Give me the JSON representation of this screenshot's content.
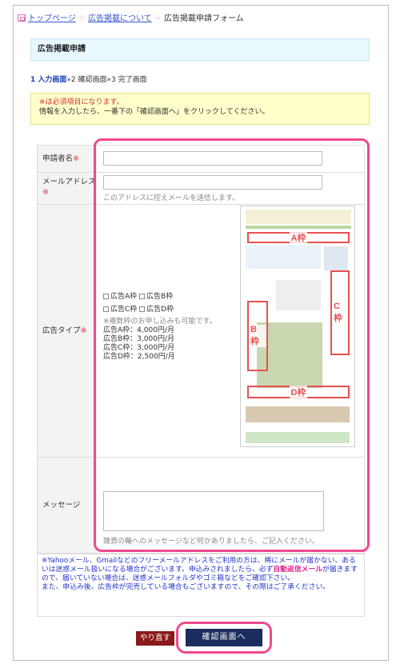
{
  "breadcrumb": {
    "home": "トップページ",
    "about": "広告掲載について",
    "current": "広告掲載申請フォーム"
  },
  "page_title": "広告掲載申請",
  "steps": {
    "step1": "1 入力画面",
    "step2": "»2 確認画面»3 完了画面"
  },
  "notice": {
    "line1": "※は必須項目になります。",
    "line2": "情報を入力したら、一番下の「確認画面へ」をクリックしてください。"
  },
  "form": {
    "name_label": "申請者名",
    "email_label": "メールアドレス",
    "email_hint": "このアドレスに控えメールを送信します。",
    "type_label": "広告タイプ",
    "required_mark": "※",
    "option_a": "広告A枠",
    "option_b": "広告B枠",
    "option_c": "広告C枠",
    "option_d": "広告D枠",
    "multi_note": "※複数枠のお申し込みも可能です。",
    "price_a": "広告A枠：4,000円/月",
    "price_b": "広告B枠：3,000円/月",
    "price_c": "広告C枠：3,000円/月",
    "price_d": "広告D枠：2,500円/月",
    "message_label": "メッセージ",
    "message_hint": "雑貨の輪へのメッセージなど何かありましたら、ご記入ください。"
  },
  "thumbnail": {
    "zone_a": "A枠",
    "zone_b": "B枠",
    "zone_c": "C枠",
    "zone_d": "D枠"
  },
  "footnote": {
    "part1": "※Yahooメール、Gmailなどのフリーメールアドレスをご利用の方は、稀にメールが届かない、あるいは迷惑メール扱いになる場合がございます。申込みされましたら、必ず",
    "highlight": "自動返信メール",
    "part2": "が届きますので、届いていない場合は、迷惑メールフォルダやゴミ箱などをご確認下さい。",
    "part3": "また、申込み後、広告枠が完売している場合もございますので、その際はご了承ください。"
  },
  "buttons": {
    "reset": "やり直す",
    "confirm": "確認画面へ"
  }
}
